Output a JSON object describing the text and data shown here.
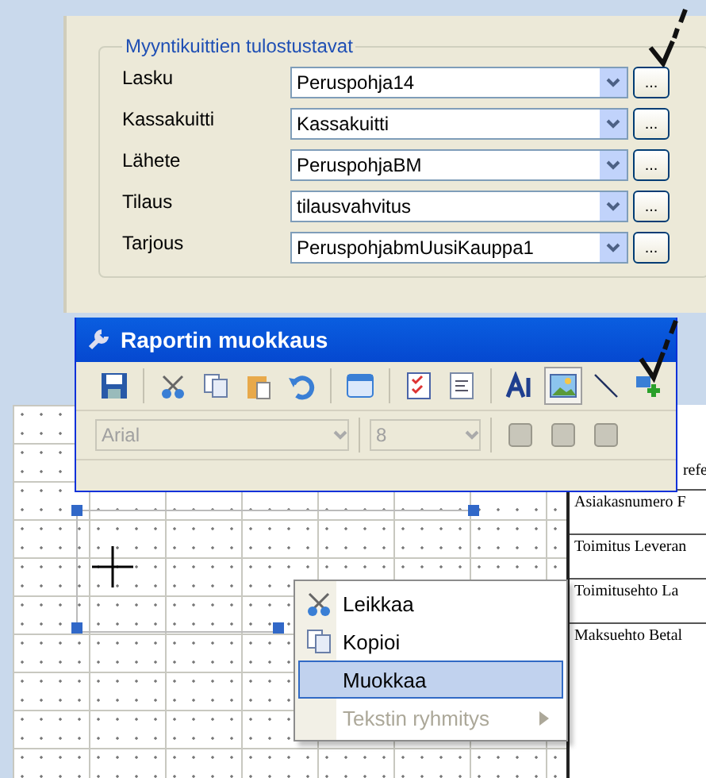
{
  "print_settings": {
    "title": "Myyntikuittien tulostustavat",
    "rows": [
      {
        "label": "Lasku",
        "value": "Peruspohja14",
        "browse": "..."
      },
      {
        "label": "Kassakuitti",
        "value": "Kassakuitti",
        "browse": "..."
      },
      {
        "label": "Lähete",
        "value": "PeruspohjaBM",
        "browse": "..."
      },
      {
        "label": "Tilaus",
        "value": "tilausvahvitus",
        "browse": "..."
      },
      {
        "label": "Tarjous",
        "value": "PeruspohjabmUusiKauppa1",
        "browse": "..."
      }
    ]
  },
  "editor": {
    "title": "Raportin muokkaus",
    "tools": [
      {
        "kind": "save",
        "selected": false
      },
      {
        "kind": "sep"
      },
      {
        "kind": "cut",
        "selected": false
      },
      {
        "kind": "copy",
        "selected": false
      },
      {
        "kind": "paste",
        "selected": false
      },
      {
        "kind": "undo",
        "selected": false
      },
      {
        "kind": "sep"
      },
      {
        "kind": "window",
        "selected": false
      },
      {
        "kind": "sep"
      },
      {
        "kind": "checklist",
        "selected": false
      },
      {
        "kind": "list",
        "selected": false
      },
      {
        "kind": "sep"
      },
      {
        "kind": "font",
        "selected": false
      },
      {
        "kind": "image",
        "selected": true
      },
      {
        "kind": "line",
        "selected": false
      },
      {
        "kind": "add",
        "selected": false
      }
    ],
    "font": {
      "value": "Arial",
      "disabled": true
    },
    "size": {
      "value": "8",
      "disabled": true
    },
    "align_buttons": [
      {
        "disabled": true
      },
      {
        "disabled": true
      },
      {
        "disabled": true
      }
    ]
  },
  "report_labels": [
    "refe",
    "Asiakasnumero F",
    "Toimitus Leveran",
    "Toimitusehto La",
    "Maksuehto Betal"
  ],
  "context_menu": [
    {
      "label": "Leikkaa",
      "kind": "cut",
      "selected": false,
      "disabled": false,
      "submenu": false
    },
    {
      "label": "Kopioi",
      "kind": "copy",
      "selected": false,
      "disabled": false,
      "submenu": false
    },
    {
      "label": "Muokkaa",
      "kind": "plain",
      "selected": true,
      "disabled": false,
      "submenu": false
    },
    {
      "label": "Tekstin ryhmitys",
      "kind": "plain",
      "selected": false,
      "disabled": true,
      "submenu": true
    }
  ]
}
